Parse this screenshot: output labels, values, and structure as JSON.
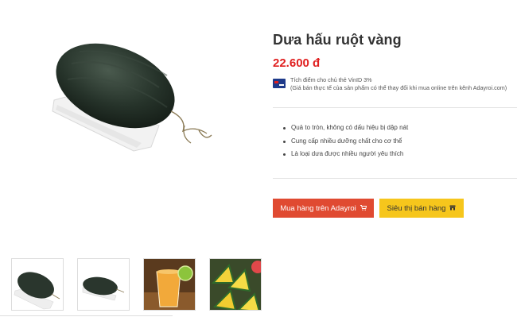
{
  "product": {
    "title": "Dưa hấu ruột vàng",
    "price": "22.600 đ",
    "vinid_line1": "Tích điểm cho chủ thẻ VinID 3%",
    "vinid_line2": "(Giá bán thực tế của sản phẩm có thể thay đổi khi mua online trên kênh Adayroi.com)",
    "features": [
      "Quả to tròn, không có dấu hiệu bị dập nát",
      "Cung cấp nhiều dưỡng chất cho cơ thể",
      "Là loại dưa được nhiều người yêu thích"
    ]
  },
  "buttons": {
    "buy_label": "Mua hàng trên Adayroi",
    "buy_icon": "cart-icon",
    "store_label": "Siêu thị bán hàng",
    "store_icon": "store-icon"
  },
  "gallery": {
    "thumbnails": [
      "watermelon-on-tray",
      "watermelon-on-tray-small",
      "juice-glass",
      "yellow-watermelon-slices"
    ]
  },
  "colors": {
    "price": "#e02020",
    "buy_button": "#e04a31",
    "store_button": "#f6c61c"
  }
}
